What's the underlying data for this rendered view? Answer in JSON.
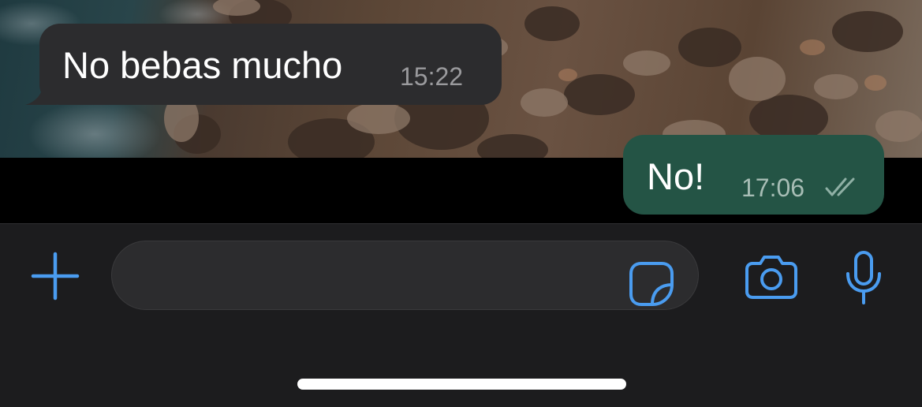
{
  "messages": [
    {
      "direction": "incoming",
      "text": "No bebas mucho",
      "time": "15:22"
    },
    {
      "direction": "outgoing",
      "text": "No!",
      "time": "17:06",
      "status_icon": "double-check-icon"
    }
  ],
  "composer": {
    "input_value": "",
    "input_placeholder": "",
    "left_button_icon": "plus-icon",
    "input_accessory_icon": "sticker-icon",
    "right_button_icons": [
      "camera-icon",
      "microphone-icon"
    ]
  },
  "colors": {
    "accent": "#4a9cf0",
    "incoming_bubble": "#2c2c2e",
    "outgoing_bubble": "#245445",
    "composer_bg": "#1c1c1e"
  }
}
